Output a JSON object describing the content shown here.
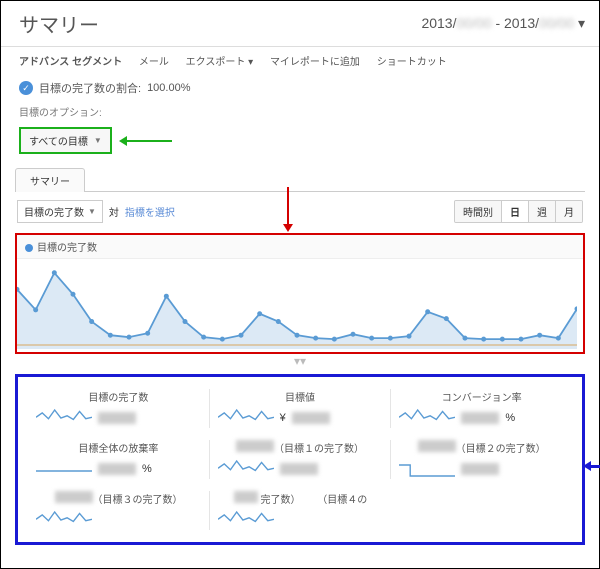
{
  "header": {
    "title": "サマリー",
    "date_range_prefix": "2013/",
    "date_range_sep": " - 2013/"
  },
  "nav": {
    "items": [
      "アドバンス セグメント",
      "メール",
      "エクスポート ▾",
      "マイレポートに追加",
      "ショートカット"
    ]
  },
  "kpi": {
    "label": "目標の完了数の割合:",
    "value": "100.00%"
  },
  "options": {
    "label": "目標のオプション:",
    "goal_select": "すべての目標"
  },
  "tabs": {
    "main": "サマリー"
  },
  "controls": {
    "metric_select": "目標の完了数",
    "vs": "対",
    "add_metric": "指標を選択",
    "granularity": [
      "時間別",
      "日",
      "週",
      "月"
    ],
    "active_index": 1
  },
  "chart": {
    "legend": "目標の完了数"
  },
  "chart_data": {
    "type": "area",
    "x": [
      1,
      2,
      3,
      4,
      5,
      6,
      7,
      8,
      9,
      10,
      11,
      12,
      13,
      14,
      15,
      16,
      17,
      18,
      19,
      20,
      21,
      22,
      23,
      24,
      25,
      26,
      27,
      28,
      29,
      30,
      31
    ],
    "values": [
      55,
      34,
      72,
      50,
      22,
      8,
      6,
      10,
      48,
      22,
      6,
      4,
      8,
      30,
      22,
      8,
      5,
      4,
      9,
      5,
      5,
      7,
      32,
      25,
      5,
      4,
      4,
      4,
      8,
      5,
      35
    ],
    "ylabel": "",
    "xlabel": "",
    "title": "目標の完了数",
    "ylim": [
      0,
      80
    ]
  },
  "metrics": {
    "row1": [
      {
        "label": "目標の完了数",
        "suffix": ""
      },
      {
        "label": "目標値",
        "prefix": "¥",
        "suffix": ""
      },
      {
        "label": "コンバージョン率",
        "suffix": "%"
      }
    ],
    "row2": [
      {
        "label": "目標全体の放棄率",
        "suffix": "%"
      },
      {
        "label": "（目標１の完了数）",
        "suffix": ""
      },
      {
        "label": "（目標２の完了数）",
        "suffix": ""
      }
    ],
    "row3": [
      {
        "label": "（目標３の完了数）",
        "suffix": ""
      },
      {
        "label": "完了数）",
        "label2": "（目標４の",
        "suffix": ""
      }
    ]
  },
  "sparkline_values": [
    12,
    18,
    10,
    22,
    11,
    14,
    9,
    20,
    10,
    12
  ]
}
